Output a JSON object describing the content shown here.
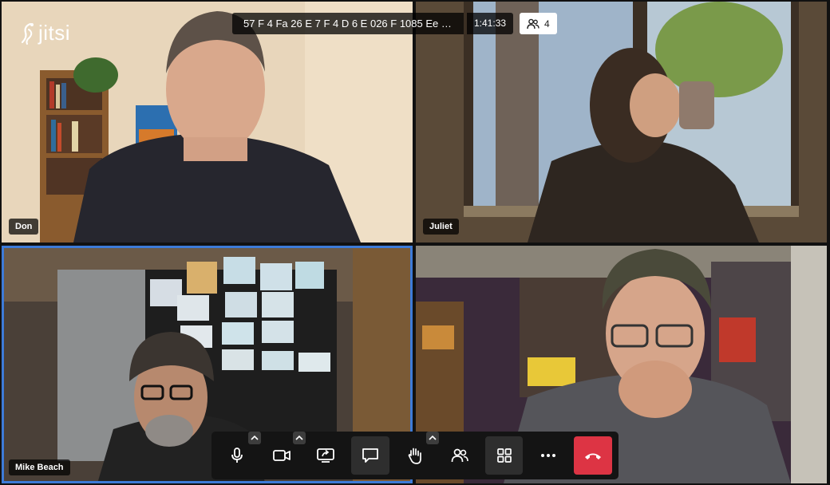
{
  "app": {
    "logo_text": "jitsi"
  },
  "header": {
    "subject": "57 F 4 Fa 26 E 7 F 4 D 6 E 026 F 1085 Ee 4...",
    "timer": "1:41:33",
    "participant_count": "4"
  },
  "participants": [
    {
      "name": "Don"
    },
    {
      "name": "Juliet"
    },
    {
      "name": "Mike Beach"
    },
    {
      "name": ""
    }
  ],
  "toolbar": {
    "buttons": [
      "microphone-icon",
      "camera-icon",
      "screenshare-icon",
      "chat-icon",
      "raise-hand-icon",
      "participants-icon",
      "tile-view-icon",
      "more-options-icon",
      "hangup-icon"
    ]
  },
  "colors": {
    "active_speaker": "#3d7bd8",
    "hangup": "#dd3444",
    "toolbar_bg": "#141414"
  }
}
